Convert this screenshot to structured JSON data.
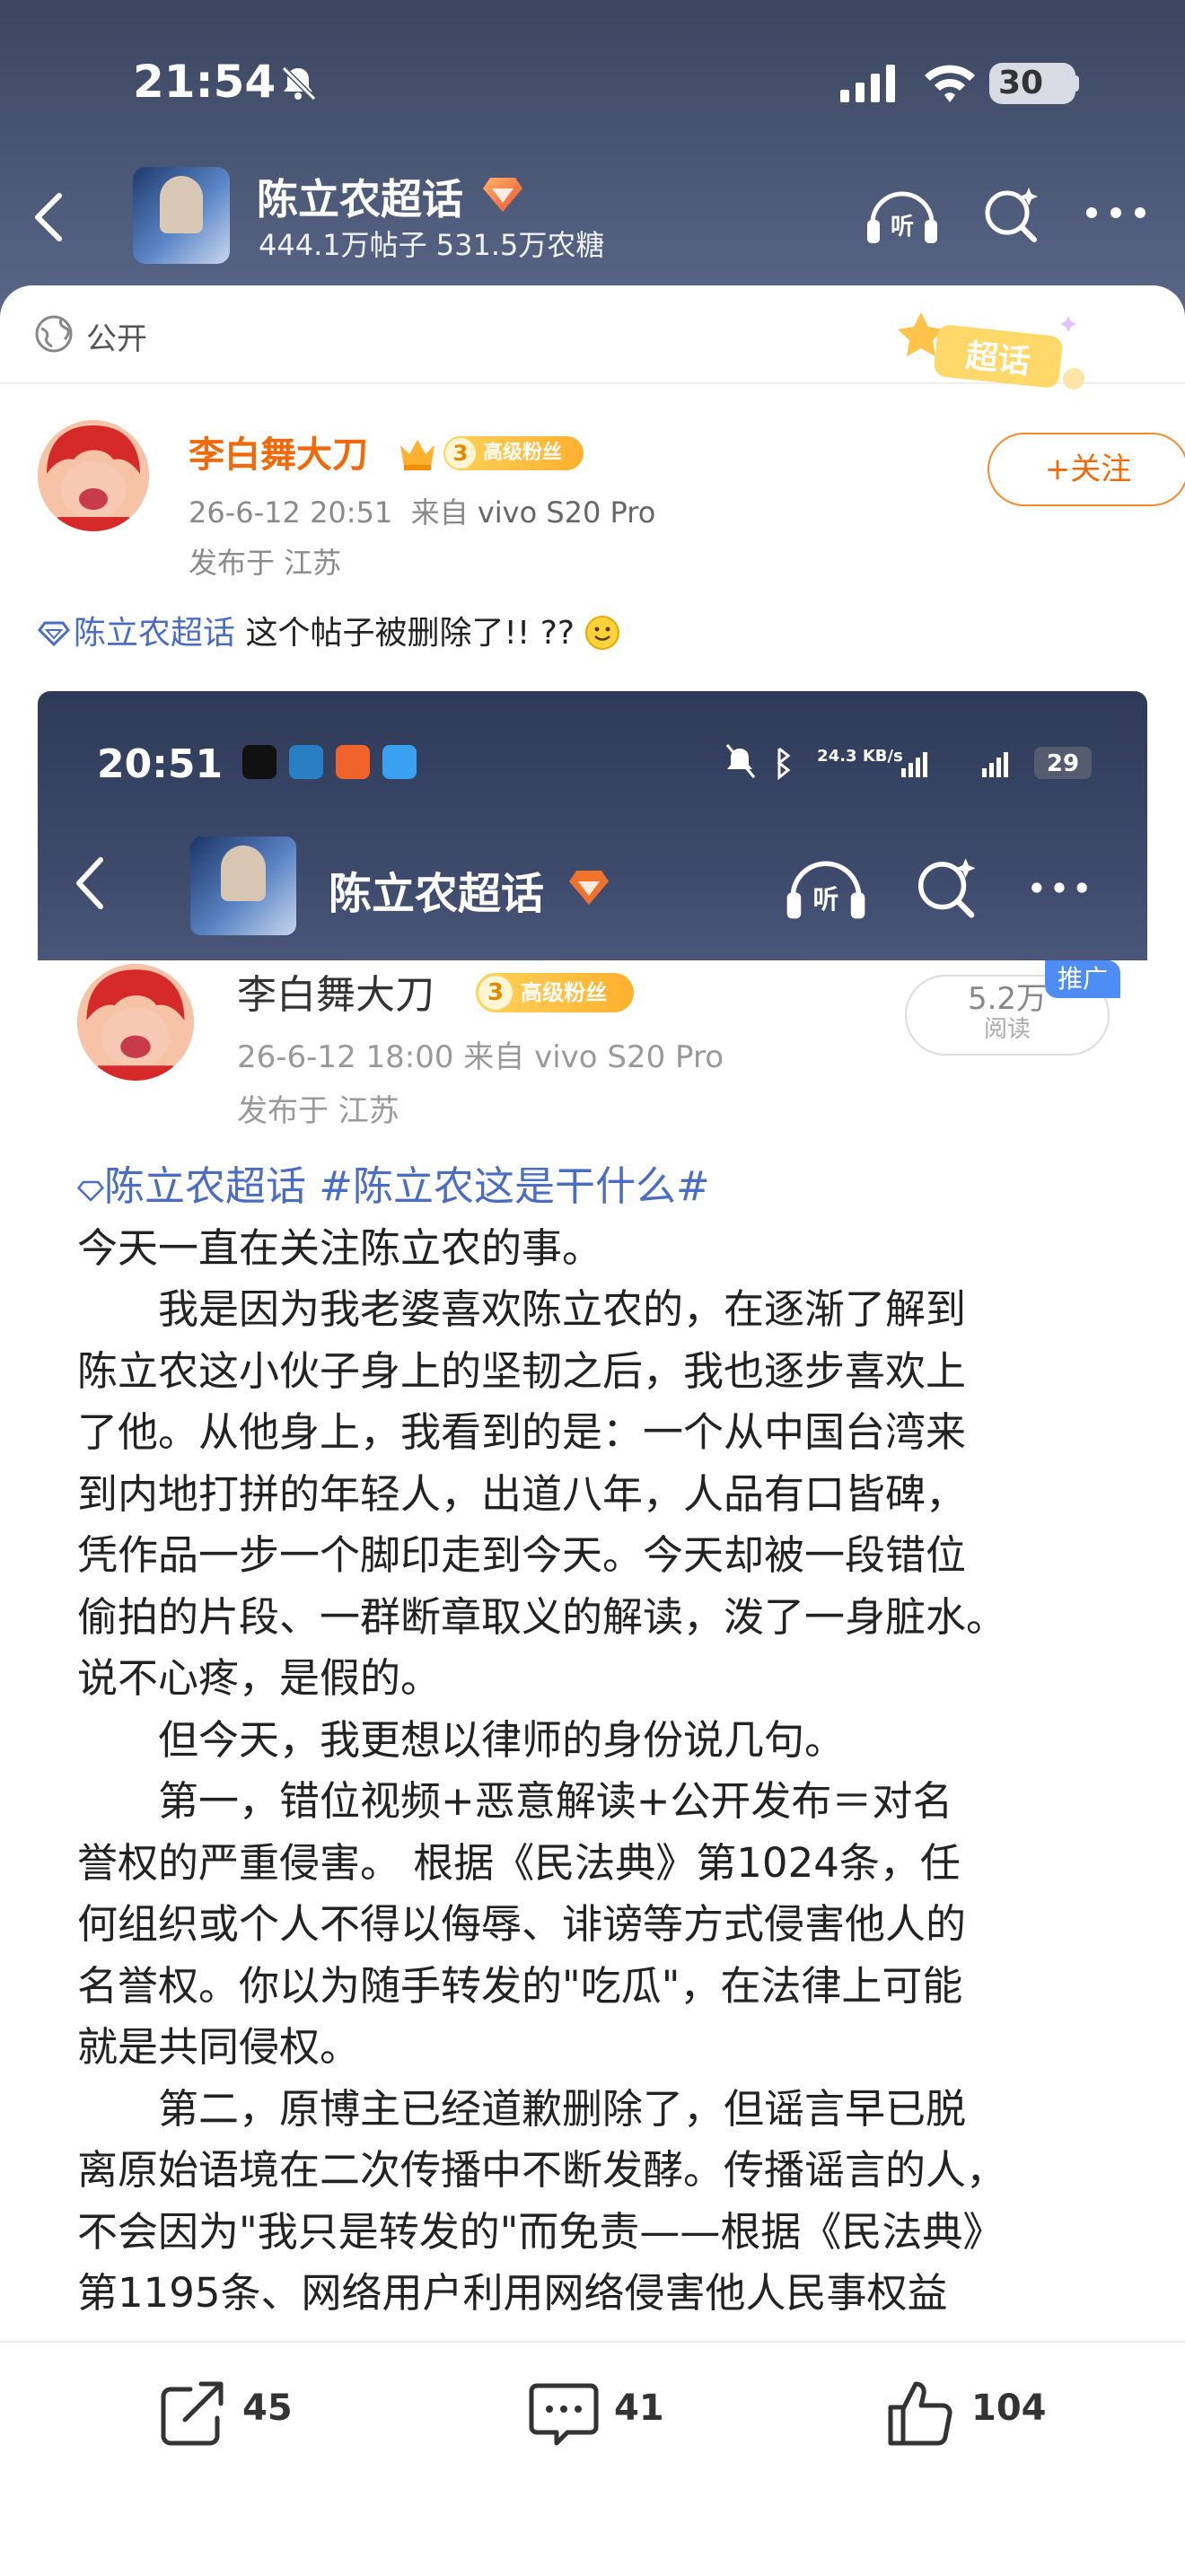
{
  "status_bar": {
    "time": "21:54",
    "battery": "30"
  },
  "topic_header": {
    "title": "陈立农超话",
    "stats": "444.1万帖子 531.5万农糖"
  },
  "visibility": {
    "label": "公开"
  },
  "stamp": {
    "label": "超话"
  },
  "author": {
    "name": "李白舞大刀",
    "fan_level": "3",
    "fan_badge": "高级粉丝",
    "timestamp": "26-6-12 20:51",
    "source": "来自",
    "device": "vivo S20 Pro",
    "location": "发布于 江苏",
    "follow_label": "+关注"
  },
  "post": {
    "topic_tag": "陈立农超话",
    "text": "这个帖子被删除了!! ??"
  },
  "screenshot": {
    "time": "20:51",
    "net_speed": "24.3 KB/s",
    "battery": "29",
    "topic_title": "陈立农超话",
    "author_name": "李白舞大刀",
    "fan_level": "3",
    "fan_badge": "高级粉丝",
    "reads": "5.2万",
    "reads_label": "阅读",
    "promo": "推广",
    "meta": "26-6-12 18:00   来自 vivo S20 Pro",
    "location": "发布于 江苏",
    "lines": [
      "陈立农超话 #陈立农这是干什么#",
      "今天一直在关注陈立农的事。",
      "　　我是因为我老婆喜欢陈立农的，在逐渐了解到",
      "陈立农这小伙子身上的坚韧之后，我也逐步喜欢上",
      "了他。从他身上，我看到的是：一个从中国台湾来",
      "到内地打拼的年轻人，出道八年，人品有口皆碑，",
      "凭作品一步一个脚印走到今天。今天却被一段错位",
      "偷拍的片段、一群断章取义的解读，泼了一身脏水。",
      "说不心疼，是假的。",
      "　　但今天，我更想以律师的身份说几句。",
      "　　第一，错位视频+恶意解读+公开发布＝对名",
      "誉权的严重侵害。 根据《民法典》第1024条，任",
      "何组织或个人不得以侮辱、诽谤等方式侵害他人的",
      "名誉权。你以为随手转发的\"吃瓜\"，在法律上可能",
      "就是共同侵权。",
      "　　第二，原博主已经道歉删除了，但谣言早已脱",
      "离原始语境在二次传播中不断发酵。传播谣言的人，",
      "不会因为\"我只是转发的\"而免责——根据《民法典》",
      "第1195条、网络用户利用网络侵害他人民事权益"
    ]
  },
  "toolbar": {
    "repost_count": "45",
    "comment_count": "41",
    "like_count": "104"
  },
  "colors": {
    "header_bg": "#3b4660",
    "author_name": "#f06a0b",
    "topic_link": "#4a6cc2",
    "fan_badge": "#ffb02e"
  }
}
